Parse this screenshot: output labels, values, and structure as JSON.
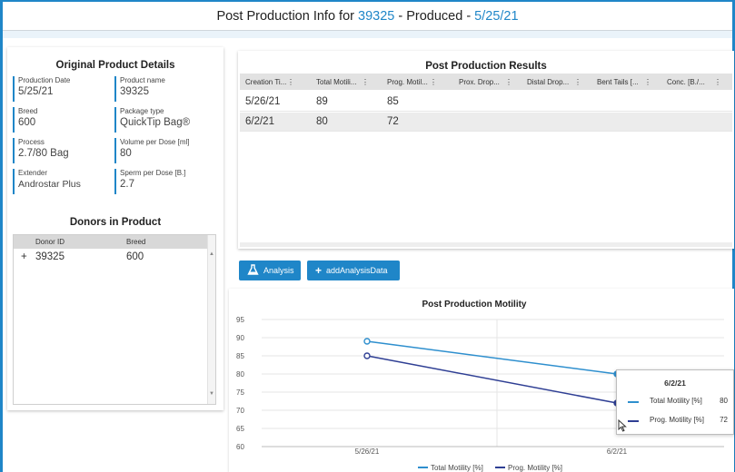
{
  "header": {
    "prefix": "Post Production Info for ",
    "product_id": "39325",
    "middle": " - Produced - ",
    "produced_date": "5/25/21"
  },
  "original": {
    "title": "Original Product Details",
    "fields": [
      {
        "label": "Production Date",
        "value": "5/25/21"
      },
      {
        "label": "Product name",
        "value": "39325"
      },
      {
        "label": "Breed",
        "value": "600"
      },
      {
        "label": "Package type",
        "value": "QuickTip Bag®"
      },
      {
        "label": "Process",
        "value": "2.7/80 Bag"
      },
      {
        "label": "Volume per Dose [ml]",
        "value": "80"
      },
      {
        "label": "Extender",
        "value": "Androstar Plus"
      },
      {
        "label": "Sperm per Dose [B.]",
        "value": "2.7"
      }
    ]
  },
  "donors": {
    "title": "Donors in Product",
    "columns": [
      "Donor ID",
      "Breed"
    ],
    "rows": [
      {
        "expand": "+",
        "id": "39325",
        "breed": "600"
      }
    ]
  },
  "results": {
    "title": "Post Production Results",
    "columns": [
      "Creation Ti...",
      "Total Motili...",
      "Prog. Motil...",
      "Prox. Drop...",
      "Distal Drop...",
      "Bent Tails [...",
      "Conc. [B./..."
    ],
    "menu_glyph": "⋮",
    "rows": [
      [
        "5/26/21",
        "89",
        "85"
      ],
      [
        "6/2/21",
        "80",
        "72"
      ]
    ]
  },
  "buttons": {
    "analysis": "Analysis",
    "add": "addAnalysisData",
    "add_icon": "+"
  },
  "colors": {
    "accent": "#1f86c8",
    "series_total": "#2e8fce",
    "series_prog": "#2f3f94"
  },
  "chart_data": {
    "type": "line",
    "title": "Post Production Motility",
    "categories": [
      "5/26/21",
      "6/2/21"
    ],
    "series": [
      {
        "name": "Total Motility [%]",
        "values": [
          89,
          80
        ],
        "color": "#2e8fce"
      },
      {
        "name": "Prog. Motility [%]",
        "values": [
          85,
          72
        ],
        "color": "#2f3f94"
      }
    ],
    "ylim": [
      60,
      95
    ],
    "yticks": [
      60,
      65,
      70,
      75,
      80,
      85,
      90,
      95
    ],
    "grid": true,
    "legend": "bottom"
  },
  "tooltip": {
    "title": "6/2/21",
    "rows": [
      {
        "name": "Total Motility [%]",
        "value": "80"
      },
      {
        "name": "Prog. Motility [%]",
        "value": "72"
      }
    ]
  }
}
